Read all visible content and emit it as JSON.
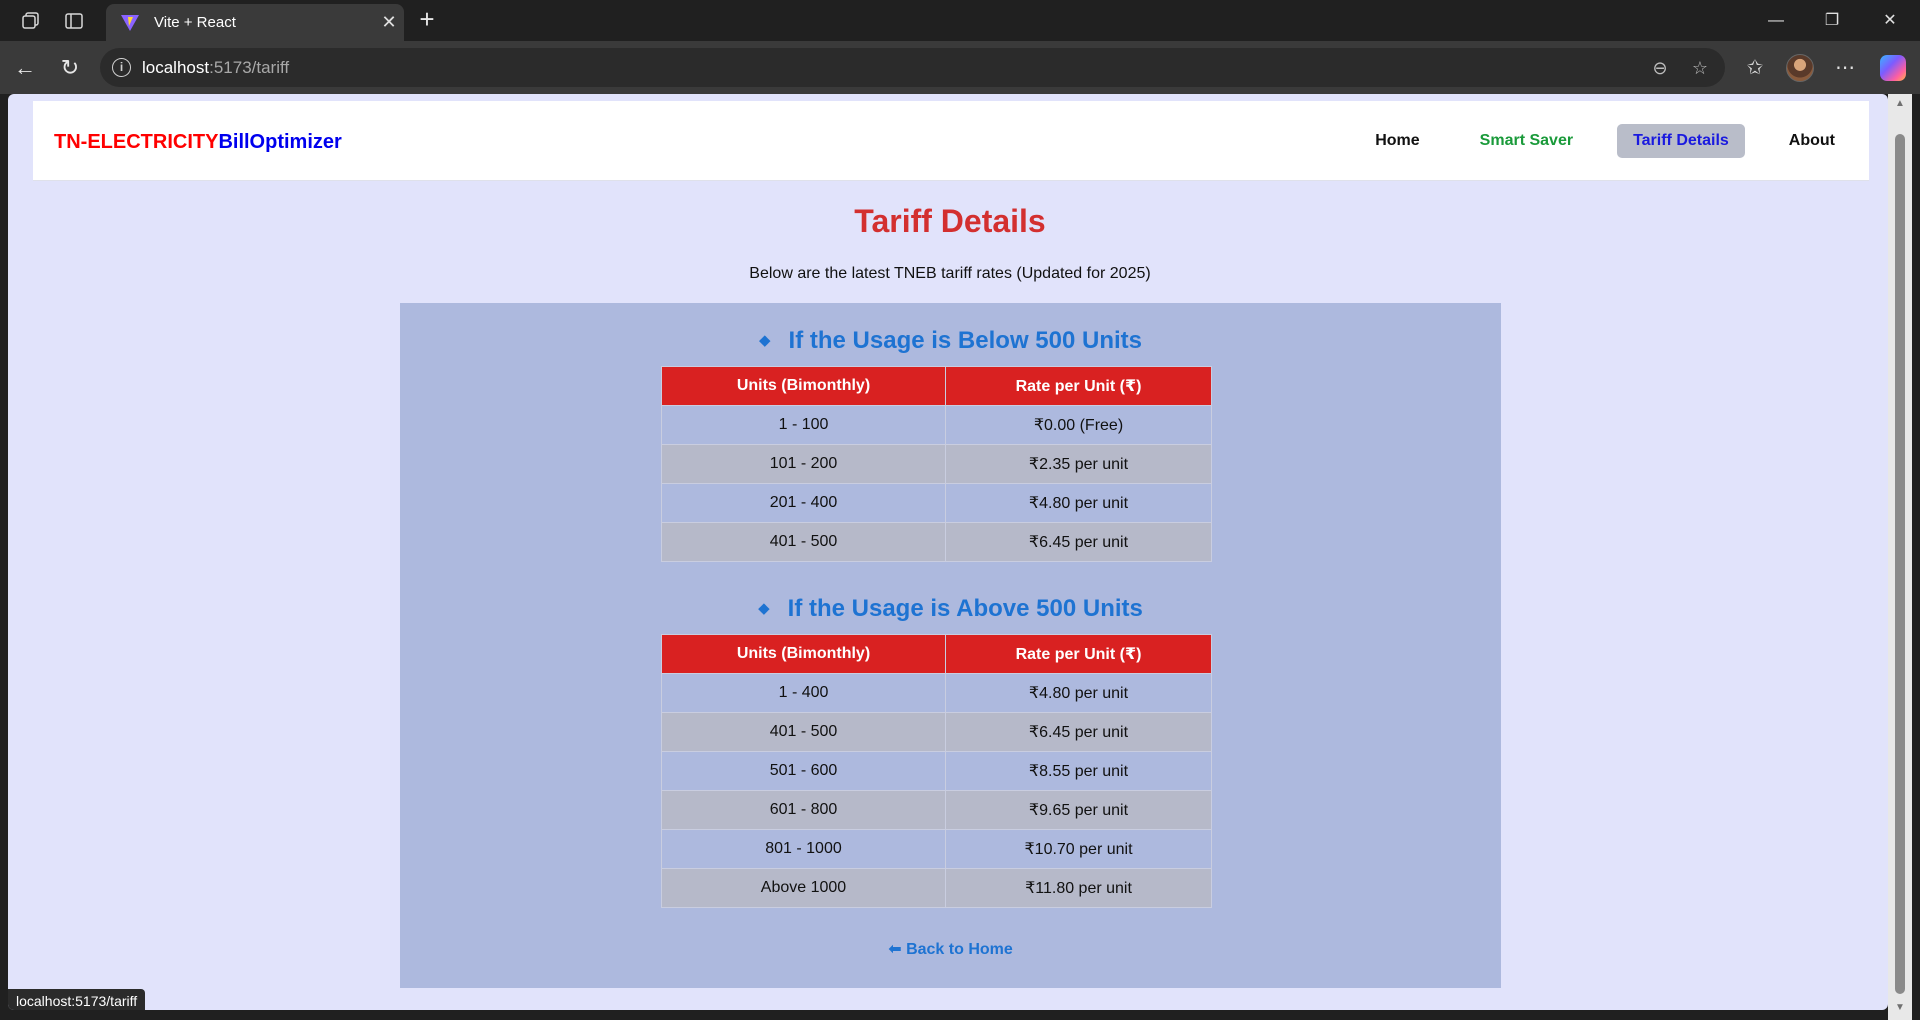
{
  "browser": {
    "tab_title": "Vite + React",
    "url_host": "localhost",
    "url_path": ":5173/tariff",
    "status_url": "localhost:5173/tariff"
  },
  "app": {
    "brand_part1": "TN-ELECTRICITY",
    "brand_part2": "BillOptimizer",
    "nav": {
      "home": "Home",
      "smart_saver": "Smart Saver",
      "tariff": "Tariff Details",
      "about": "About"
    }
  },
  "main": {
    "title": "Tariff Details",
    "subtitle": "Below are the latest TNEB tariff rates (Updated for 2025)",
    "section1": {
      "heading": "If the Usage is Below 500 Units",
      "columns": [
        "Units (Bimonthly)",
        "Rate per Unit (₹)"
      ],
      "rows": [
        [
          "1 - 100",
          "₹0.00 (Free)"
        ],
        [
          "101 - 200",
          "₹2.35 per unit"
        ],
        [
          "201 - 400",
          "₹4.80 per unit"
        ],
        [
          "401 - 500",
          "₹6.45 per unit"
        ]
      ]
    },
    "section2": {
      "heading": "If the Usage is Above 500 Units",
      "columns": [
        "Units (Bimonthly)",
        "Rate per Unit (₹)"
      ],
      "rows": [
        [
          "1 - 400",
          "₹4.80 per unit"
        ],
        [
          "401 - 500",
          "₹6.45 per unit"
        ],
        [
          "501 - 600",
          "₹8.55 per unit"
        ],
        [
          "601 - 800",
          "₹9.65 per unit"
        ],
        [
          "801 - 1000",
          "₹10.70 per unit"
        ],
        [
          "Above 1000",
          "₹11.80 per unit"
        ]
      ]
    },
    "back_link": "⬅ Back to Home"
  }
}
